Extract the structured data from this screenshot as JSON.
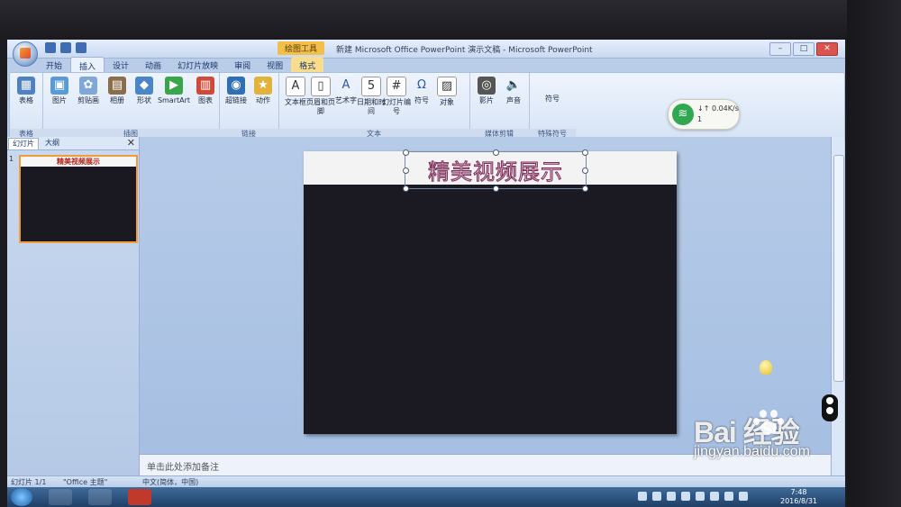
{
  "window": {
    "contextual_tool": "绘图工具",
    "title": "新建 Microsoft Office PowerPoint 演示文稿 - Microsoft PowerPoint",
    "min": "–",
    "max": "□",
    "close": "✕"
  },
  "tabs": [
    "开始",
    "插入",
    "设计",
    "动画",
    "幻灯片放映",
    "审阅",
    "视图",
    "格式"
  ],
  "ribbon": {
    "groups": [
      {
        "label": "表格",
        "buttons": [
          "表格"
        ]
      },
      {
        "label": "插图",
        "buttons": [
          "图片",
          "剪贴画",
          "相册",
          "形状",
          "SmartArt",
          "图表"
        ]
      },
      {
        "label": "链接",
        "buttons": [
          "超链接",
          "动作"
        ]
      },
      {
        "label": "文本",
        "buttons": [
          "文本框",
          "页眉和页脚",
          "艺术字",
          "日期和时间",
          "幻灯片编号",
          "符号",
          "对象"
        ]
      },
      {
        "label": "媒体剪辑",
        "buttons": [
          "影片",
          "声音"
        ]
      },
      {
        "label": "特殊符号",
        "buttons": [
          "符号"
        ]
      }
    ]
  },
  "network": {
    "speed": "↓↑ 0.04K/s",
    "count": "1"
  },
  "panel": {
    "tab_slides": "幻灯片",
    "tab_outline": "大纲",
    "close": "✕",
    "slide_number": "1",
    "thumb_title": "精美视频展示"
  },
  "slide": {
    "title": "精美视频展示"
  },
  "notes": {
    "placeholder": "单击此处添加备注"
  },
  "status": {
    "slide": "幻灯片 1/1",
    "theme": "\"Office 主题\"",
    "lang": "中文(简体，中国)"
  },
  "clock": {
    "time": "7:48",
    "date": "2016/8/31"
  },
  "watermark": {
    "brand": "Bai  经验",
    "url": "jingyan.baidu.com"
  }
}
